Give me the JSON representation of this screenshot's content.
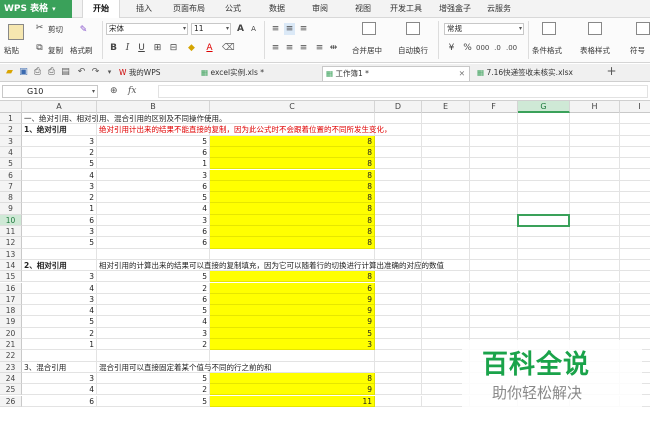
{
  "app": {
    "name": "WPS 表格",
    "accent": "#3aa15a"
  },
  "menu": [
    "开始",
    "插入",
    "页面布局",
    "公式",
    "数据",
    "审阅",
    "视图",
    "开发工具",
    "增强盒子",
    "云服务"
  ],
  "active_menu": "开始",
  "ribbon": {
    "cut": "剪切",
    "copy": "复制",
    "format_painter": "格式刷",
    "paste": "粘贴",
    "font_name": "宋体",
    "font_size": "11",
    "merge_center": "合并居中",
    "wrap_text": "自动换行",
    "number_format": "常规",
    "conditional_format": "条件格式",
    "table_style": "表格样式",
    "symbol": "符号"
  },
  "tabs": [
    {
      "label": "我的WPS"
    },
    {
      "label": "excel实例.xls *"
    },
    {
      "label": "工作簿1 *"
    },
    {
      "label": "7.16快递签收未核实.xlsx"
    }
  ],
  "active_tab": "工作簿1 *",
  "formula_bar": {
    "name_box": "G10",
    "fx": "fx",
    "content": ""
  },
  "columns": [
    "A",
    "B",
    "C",
    "D",
    "E",
    "F",
    "G",
    "H",
    "I"
  ],
  "selected_col": "G",
  "selected_row": "10",
  "rows": [
    {
      "n": "1",
      "a": "一、绝对引用、相对引用、混合引用的区别及不同操作使用。"
    },
    {
      "n": "2",
      "a": "1、绝对引用",
      "b": "绝对引用计出来的结果不能直接的复制，因为此公式时不会跟着位置的不同所发生变化，"
    },
    {
      "n": "3",
      "a": "3",
      "b": "5",
      "c": "8"
    },
    {
      "n": "4",
      "a": "2",
      "b": "6",
      "c": "8"
    },
    {
      "n": "5",
      "a": "5",
      "b": "1",
      "c": "8"
    },
    {
      "n": "6",
      "a": "4",
      "b": "3",
      "c": "8"
    },
    {
      "n": "7",
      "a": "3",
      "b": "6",
      "c": "8"
    },
    {
      "n": "8",
      "a": "2",
      "b": "5",
      "c": "8"
    },
    {
      "n": "9",
      "a": "1",
      "b": "4",
      "c": "8"
    },
    {
      "n": "10",
      "a": "6",
      "b": "3",
      "c": "8"
    },
    {
      "n": "11",
      "a": "3",
      "b": "6",
      "c": "8"
    },
    {
      "n": "12",
      "a": "5",
      "b": "6",
      "c": "8"
    },
    {
      "n": "13"
    },
    {
      "n": "14",
      "a": "2、相对引用",
      "b": "相对引用的计算出来的结果可以直接的复制填充，因为它可以随着行的切换进行计算出准确的对应的数值"
    },
    {
      "n": "15",
      "a": "3",
      "b": "5",
      "c": "8"
    },
    {
      "n": "16",
      "a": "4",
      "b": "2",
      "c": "6"
    },
    {
      "n": "17",
      "a": "3",
      "b": "6",
      "c": "9"
    },
    {
      "n": "18",
      "a": "4",
      "b": "5",
      "c": "9"
    },
    {
      "n": "19",
      "a": "5",
      "b": "4",
      "c": "9"
    },
    {
      "n": "20",
      "a": "2",
      "b": "3",
      "c": "5"
    },
    {
      "n": "21",
      "a": "1",
      "b": "2",
      "c": "3"
    },
    {
      "n": "22"
    },
    {
      "n": "23",
      "a": "3、混合引用",
      "b": "混合引用可以直接固定着某个值与不同的行之前的和"
    },
    {
      "n": "24",
      "a": "3",
      "b": "5",
      "c": "8"
    },
    {
      "n": "25",
      "a": "4",
      "b": "2",
      "c": "9"
    },
    {
      "n": "26",
      "a": "6",
      "b": "5",
      "c": "11"
    }
  ],
  "watermark": {
    "title": "百科全说",
    "subtitle": "助你轻松解决"
  }
}
